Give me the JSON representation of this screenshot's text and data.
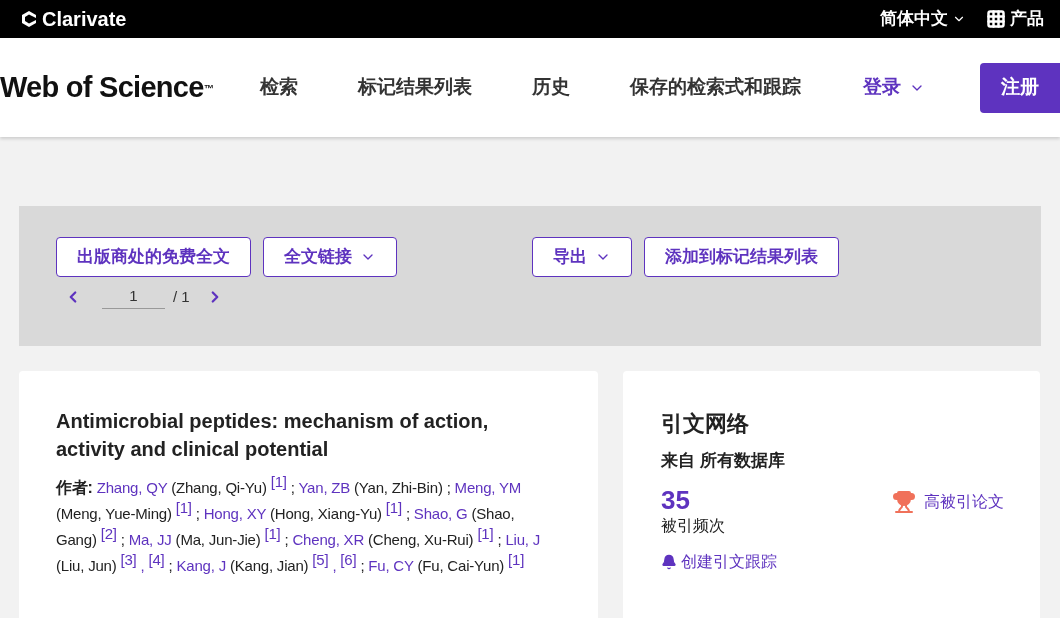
{
  "top_bar": {
    "brand": "Clarivate",
    "language": "简体中文",
    "products": "产品"
  },
  "header": {
    "logo": "Web of Science",
    "logo_mark": "™",
    "nav": [
      "检索",
      "标记结果列表",
      "历史",
      "保存的检索式和跟踪"
    ],
    "login": "登录",
    "register": "注册"
  },
  "toolbar": {
    "buttons": [
      {
        "label": "出版商处的免费全文",
        "dropdown": false
      },
      {
        "label": "全文链接",
        "dropdown": true
      },
      {
        "label": "导出",
        "dropdown": true
      },
      {
        "label": "添加到标记结果列表",
        "dropdown": false
      }
    ],
    "page_value": "1",
    "page_total": "/ 1"
  },
  "record": {
    "title": "Antimicrobial peptides: mechanism of action, activity and clinical potential",
    "authors_label": "作者:",
    "author_separator": ";",
    "ref_separator": ",",
    "authors": [
      {
        "short": "Zhang, QY",
        "full": "(Zhang, Qi-Yu)",
        "refs": [
          "[1]"
        ]
      },
      {
        "short": "Yan, ZB",
        "full": "(Yan, Zhi-Bin)"
      },
      {
        "short": "Meng, YM",
        "full": "(Meng, Yue-Ming)",
        "refs": [
          "[1]"
        ]
      },
      {
        "short": "Hong, XY",
        "full": "(Hong, Xiang-Yu)",
        "refs": [
          "[1]"
        ]
      },
      {
        "short": "Shao, G",
        "full": "(Shao, Gang)",
        "refs": [
          "[2]"
        ]
      },
      {
        "short": "Ma, JJ",
        "full": "(Ma, Jun-Jie)",
        "refs": [
          "[1]"
        ]
      },
      {
        "short": "Cheng, XR",
        "full": "(Cheng, Xu-Rui)",
        "refs": [
          "[1]"
        ]
      },
      {
        "short": "Liu, J",
        "full": "(Liu, Jun)",
        "refs": [
          "[3]",
          "[4]"
        ]
      },
      {
        "short": "Kang, J",
        "full": "(Kang, Jian)",
        "refs": [
          "[5]",
          "[6]"
        ]
      },
      {
        "short": "Fu, CY",
        "full": "(Fu, Cai-Yun)",
        "refs": [
          "[1]"
        ]
      }
    ]
  },
  "citation_network": {
    "title": "引文网络",
    "source": "来自 所有数据库",
    "count": "35",
    "count_label": "被引频次",
    "highly_cited": "高被引论文",
    "create_alert": "创建引文跟踪"
  }
}
